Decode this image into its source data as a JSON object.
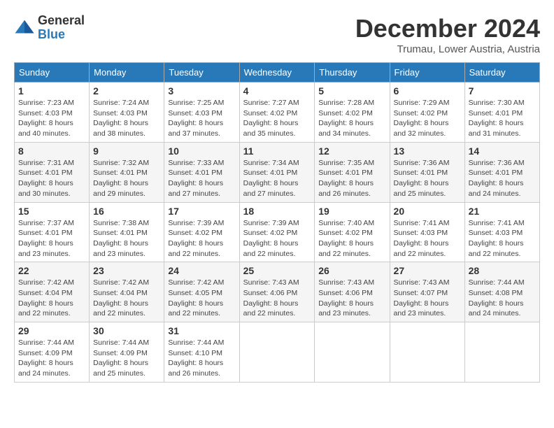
{
  "header": {
    "logo": {
      "general": "General",
      "blue": "Blue"
    },
    "title": "December 2024",
    "location": "Trumau, Lower Austria, Austria"
  },
  "calendar": {
    "days_of_week": [
      "Sunday",
      "Monday",
      "Tuesday",
      "Wednesday",
      "Thursday",
      "Friday",
      "Saturday"
    ],
    "weeks": [
      [
        null,
        {
          "day": 2,
          "sunrise": "7:24 AM",
          "sunset": "4:03 PM",
          "daylight": "8 hours and 38 minutes."
        },
        {
          "day": 3,
          "sunrise": "7:25 AM",
          "sunset": "4:03 PM",
          "daylight": "8 hours and 37 minutes."
        },
        {
          "day": 4,
          "sunrise": "7:27 AM",
          "sunset": "4:02 PM",
          "daylight": "8 hours and 35 minutes."
        },
        {
          "day": 5,
          "sunrise": "7:28 AM",
          "sunset": "4:02 PM",
          "daylight": "8 hours and 34 minutes."
        },
        {
          "day": 6,
          "sunrise": "7:29 AM",
          "sunset": "4:02 PM",
          "daylight": "8 hours and 32 minutes."
        },
        {
          "day": 7,
          "sunrise": "7:30 AM",
          "sunset": "4:01 PM",
          "daylight": "8 hours and 31 minutes."
        }
      ],
      [
        {
          "day": 1,
          "sunrise": "7:23 AM",
          "sunset": "4:03 PM",
          "daylight": "8 hours and 40 minutes."
        },
        {
          "day": 8,
          "sunrise": "7:31 AM",
          "sunset": "4:01 PM",
          "daylight": "8 hours and 30 minutes."
        },
        {
          "day": 9,
          "sunrise": "7:32 AM",
          "sunset": "4:01 PM",
          "daylight": "8 hours and 29 minutes."
        },
        {
          "day": 10,
          "sunrise": "7:33 AM",
          "sunset": "4:01 PM",
          "daylight": "8 hours and 27 minutes."
        },
        {
          "day": 11,
          "sunrise": "7:34 AM",
          "sunset": "4:01 PM",
          "daylight": "8 hours and 27 minutes."
        },
        {
          "day": 12,
          "sunrise": "7:35 AM",
          "sunset": "4:01 PM",
          "daylight": "8 hours and 26 minutes."
        },
        {
          "day": 13,
          "sunrise": "7:36 AM",
          "sunset": "4:01 PM",
          "daylight": "8 hours and 25 minutes."
        },
        {
          "day": 14,
          "sunrise": "7:36 AM",
          "sunset": "4:01 PM",
          "daylight": "8 hours and 24 minutes."
        }
      ],
      [
        {
          "day": 15,
          "sunrise": "7:37 AM",
          "sunset": "4:01 PM",
          "daylight": "8 hours and 23 minutes."
        },
        {
          "day": 16,
          "sunrise": "7:38 AM",
          "sunset": "4:01 PM",
          "daylight": "8 hours and 23 minutes."
        },
        {
          "day": 17,
          "sunrise": "7:39 AM",
          "sunset": "4:02 PM",
          "daylight": "8 hours and 22 minutes."
        },
        {
          "day": 18,
          "sunrise": "7:39 AM",
          "sunset": "4:02 PM",
          "daylight": "8 hours and 22 minutes."
        },
        {
          "day": 19,
          "sunrise": "7:40 AM",
          "sunset": "4:02 PM",
          "daylight": "8 hours and 22 minutes."
        },
        {
          "day": 20,
          "sunrise": "7:41 AM",
          "sunset": "4:03 PM",
          "daylight": "8 hours and 22 minutes."
        },
        {
          "day": 21,
          "sunrise": "7:41 AM",
          "sunset": "4:03 PM",
          "daylight": "8 hours and 22 minutes."
        }
      ],
      [
        {
          "day": 22,
          "sunrise": "7:42 AM",
          "sunset": "4:04 PM",
          "daylight": "8 hours and 22 minutes."
        },
        {
          "day": 23,
          "sunrise": "7:42 AM",
          "sunset": "4:04 PM",
          "daylight": "8 hours and 22 minutes."
        },
        {
          "day": 24,
          "sunrise": "7:42 AM",
          "sunset": "4:05 PM",
          "daylight": "8 hours and 22 minutes."
        },
        {
          "day": 25,
          "sunrise": "7:43 AM",
          "sunset": "4:06 PM",
          "daylight": "8 hours and 22 minutes."
        },
        {
          "day": 26,
          "sunrise": "7:43 AM",
          "sunset": "4:06 PM",
          "daylight": "8 hours and 23 minutes."
        },
        {
          "day": 27,
          "sunrise": "7:43 AM",
          "sunset": "4:07 PM",
          "daylight": "8 hours and 23 minutes."
        },
        {
          "day": 28,
          "sunrise": "7:44 AM",
          "sunset": "4:08 PM",
          "daylight": "8 hours and 24 minutes."
        }
      ],
      [
        {
          "day": 29,
          "sunrise": "7:44 AM",
          "sunset": "4:09 PM",
          "daylight": "8 hours and 24 minutes."
        },
        {
          "day": 30,
          "sunrise": "7:44 AM",
          "sunset": "4:09 PM",
          "daylight": "8 hours and 25 minutes."
        },
        {
          "day": 31,
          "sunrise": "7:44 AM",
          "sunset": "4:10 PM",
          "daylight": "8 hours and 26 minutes."
        },
        null,
        null,
        null,
        null
      ]
    ]
  }
}
